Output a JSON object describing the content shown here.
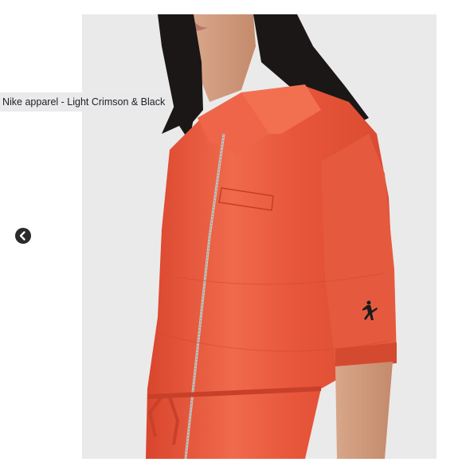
{
  "gallery": {
    "caption": "Nike apparel  - Light Crimson & Black",
    "prev_icon": "chevron-left-icon",
    "product_image": {
      "subject": "orange-red satin zip-front short sleeve jumpsuit with Jumpman logo",
      "accent_color": "#e8563a",
      "logo_icon": "jumpman-logo-icon"
    }
  }
}
